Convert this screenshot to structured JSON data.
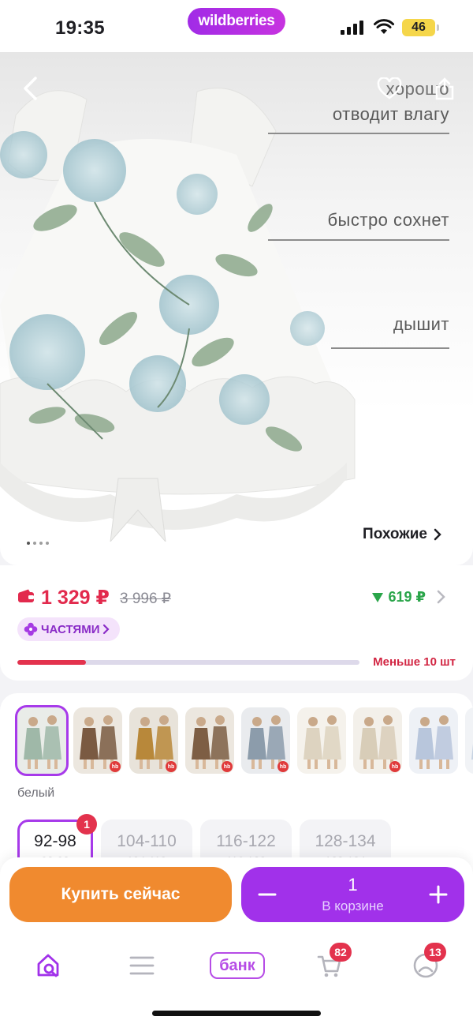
{
  "status_bar": {
    "time": "19:35",
    "brand": "wildberries",
    "battery": "46"
  },
  "hero": {
    "features": [
      "хорошо",
      "отводит влагу",
      "быстро сохнет",
      "дышит"
    ],
    "similar_label": "Похожие",
    "icons": [
      "back-arrow-icon",
      "heart-icon",
      "share-icon",
      "chevron-right-icon"
    ],
    "slides_count": 4
  },
  "price": {
    "current": "1 329 ₽",
    "old": "3 996 ₽",
    "bonus": "619 ₽",
    "installments_label": "ЧАСТЯМИ",
    "stock_label": "Меньше 10 шт",
    "stock_progress": 0.2,
    "accent_color": "#e22a4d",
    "bonus_color": "#2aa54a"
  },
  "variants": {
    "color_label": "белый",
    "thumbnails": [
      {
        "name": "white-floral",
        "selected": true,
        "bg": "#e9ece8",
        "accent": "#9fb8a8"
      },
      {
        "name": "brown-1",
        "selected": false,
        "bg": "#ece7df",
        "accent": "#7a5a42",
        "badge": true
      },
      {
        "name": "mustard",
        "selected": false,
        "bg": "#e8e3da",
        "accent": "#b8883a",
        "badge": true
      },
      {
        "name": "brown-2",
        "selected": false,
        "bg": "#ece7df",
        "accent": "#7d5e44",
        "badge": true
      },
      {
        "name": "grey-blue",
        "selected": false,
        "bg": "#e9ebee",
        "accent": "#8c9cab",
        "badge": true
      },
      {
        "name": "faded-1",
        "selected": false,
        "bg": "#f5f2ec",
        "accent": "#ddd3c0"
      },
      {
        "name": "faded-2",
        "selected": false,
        "bg": "#f3f0ea",
        "accent": "#d8cdb8",
        "badge": true
      },
      {
        "name": "faded-3",
        "selected": false,
        "bg": "#eef1f6",
        "accent": "#b8c6dc"
      },
      {
        "name": "faded-4",
        "selected": false,
        "bg": "#f1f3f6",
        "accent": "#c7d3e2"
      }
    ],
    "sizes": [
      {
        "label": "92-98",
        "sub": "92-98",
        "selected": true,
        "badge": "1"
      },
      {
        "label": "104-110",
        "sub": "104-110",
        "selected": false
      },
      {
        "label": "116-122",
        "sub": "116-122",
        "selected": false
      },
      {
        "label": "128-134",
        "sub": "128-134",
        "selected": false
      }
    ]
  },
  "actions": {
    "buy_now": "Купить сейчас",
    "cart_qty": "1",
    "cart_label": "В корзине",
    "buy_color": "#f08a2f",
    "cart_color": "#a131ea"
  },
  "nav": {
    "items": [
      "home-search",
      "catalog",
      "bank",
      "cart",
      "profile"
    ],
    "bank_label": "банк",
    "cart_badge": "82",
    "profile_badge": "13"
  }
}
